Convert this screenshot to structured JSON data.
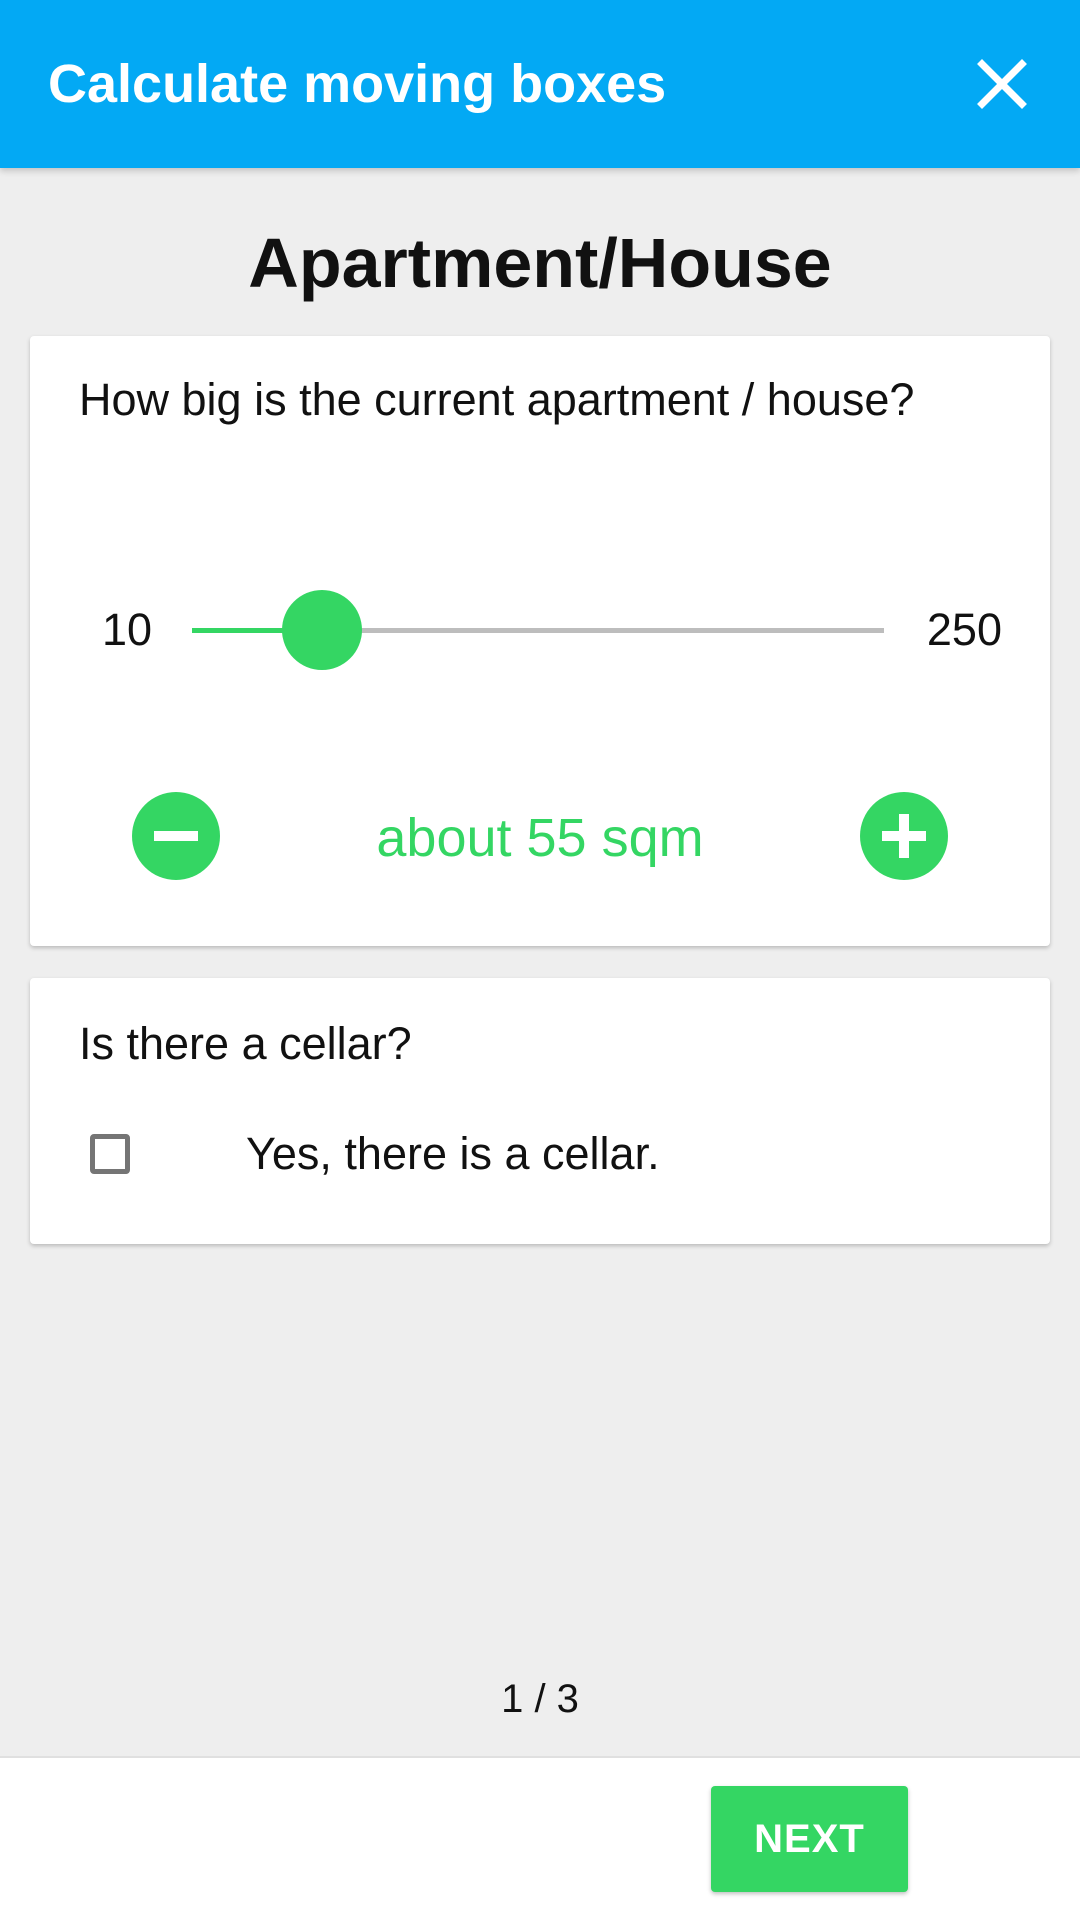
{
  "app": {
    "title": "Calculate moving boxes",
    "close_icon": "close-icon"
  },
  "section": {
    "title": "Apartment/House"
  },
  "size_card": {
    "question": "How big is the current apartment / house?",
    "slider": {
      "min_label": "10",
      "max_label": "250",
      "min": 10,
      "max": 250,
      "value": 55
    },
    "minus_icon": "minus-circle-icon",
    "plus_icon": "plus-circle-icon",
    "value_text": "about 55 sqm"
  },
  "cellar_card": {
    "question": "Is there a cellar?",
    "checkbox_label": "Yes, there is a cellar.",
    "checked": false
  },
  "pager": {
    "text": "1 / 3"
  },
  "footer": {
    "next_label": "NEXT"
  },
  "colors": {
    "header": "#03a9f4",
    "accent": "#34d663",
    "background": "#eeeeee",
    "track": "#bdbdbd"
  }
}
